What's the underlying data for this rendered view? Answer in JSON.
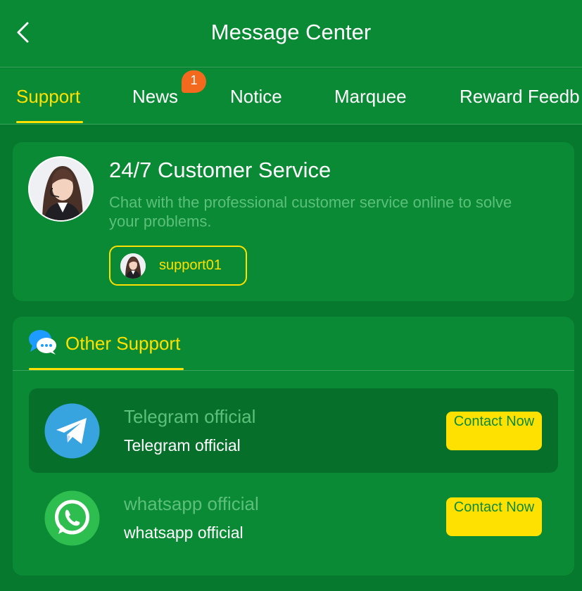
{
  "header": {
    "title": "Message Center",
    "back_icon": "chevron-left-icon"
  },
  "tabs": [
    {
      "label": "Support",
      "active": true
    },
    {
      "label": "News",
      "badge": "1"
    },
    {
      "label": "Notice"
    },
    {
      "label": "Marquee"
    },
    {
      "label": "Reward Feedb"
    }
  ],
  "service": {
    "title": "24/7 Customer Service",
    "description": "Chat with the professional customer service online to solve your problems.",
    "agent": {
      "name": "support01",
      "avatar_icon": "agent-avatar-icon"
    }
  },
  "other_support": {
    "title": "Other Support",
    "icon": "chat-bubble-icon",
    "items": [
      {
        "title": "Telegram official",
        "subtitle": "Telegram official",
        "button": "Contact Now",
        "icon": "telegram-icon"
      },
      {
        "title": "whatsapp official",
        "subtitle": "whatsapp official",
        "button": "Contact Now",
        "icon": "whatsapp-icon"
      }
    ]
  },
  "colors": {
    "background": "#07792e",
    "card": "#0a8a35",
    "accent": "#ffe100",
    "muted_text": "#5cc07a",
    "badge": "#f36a1e"
  }
}
